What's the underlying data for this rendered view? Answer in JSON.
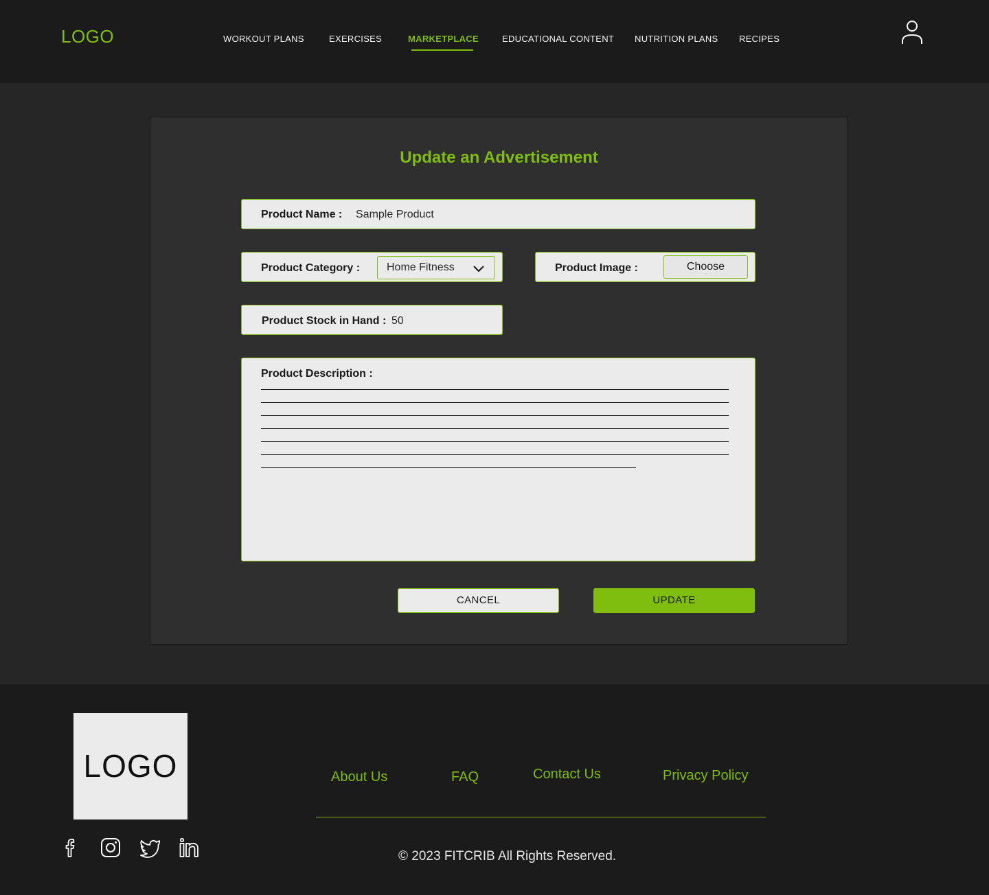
{
  "header": {
    "logo": "LOGO",
    "nav": [
      {
        "label": "WORKOUT PLANS",
        "active": false
      },
      {
        "label": "EXERCISES",
        "active": false
      },
      {
        "label": "MARKETPLACE",
        "active": true
      },
      {
        "label": "EDUCATIONAL CONTENT",
        "active": false
      },
      {
        "label": "NUTRITION PLANS",
        "active": false
      },
      {
        "label": "RECIPES",
        "active": false
      }
    ],
    "profile_icon": "user-icon"
  },
  "form": {
    "title": "Update an Advertisement",
    "product_name": {
      "label": "Product Name :",
      "value": "Sample Product"
    },
    "product_category": {
      "label": "Product Category :",
      "value": "Home Fitness"
    },
    "product_image": {
      "label": "Product Image :",
      "button": "Choose"
    },
    "product_stock": {
      "label": "Product Stock in Hand :",
      "value": "50"
    },
    "product_description": {
      "label": "Product Description :"
    },
    "cancel_label": "CANCEL",
    "update_label": "UPDATE"
  },
  "footer": {
    "logo": "LOGO",
    "links": [
      "About Us",
      "FAQ",
      "Contact Us",
      "Privacy Policy"
    ],
    "social": [
      "facebook-icon",
      "instagram-icon",
      "twitter-icon",
      "linkedin-icon"
    ],
    "copyright": "© 2023 FITCRIB All Rights Reserved."
  },
  "colors": {
    "accent": "#7fbe0e",
    "header_bg": "#1b1b1b",
    "page_bg": "#262626",
    "card_bg": "#302f30",
    "field_bg": "#ebebeb"
  }
}
